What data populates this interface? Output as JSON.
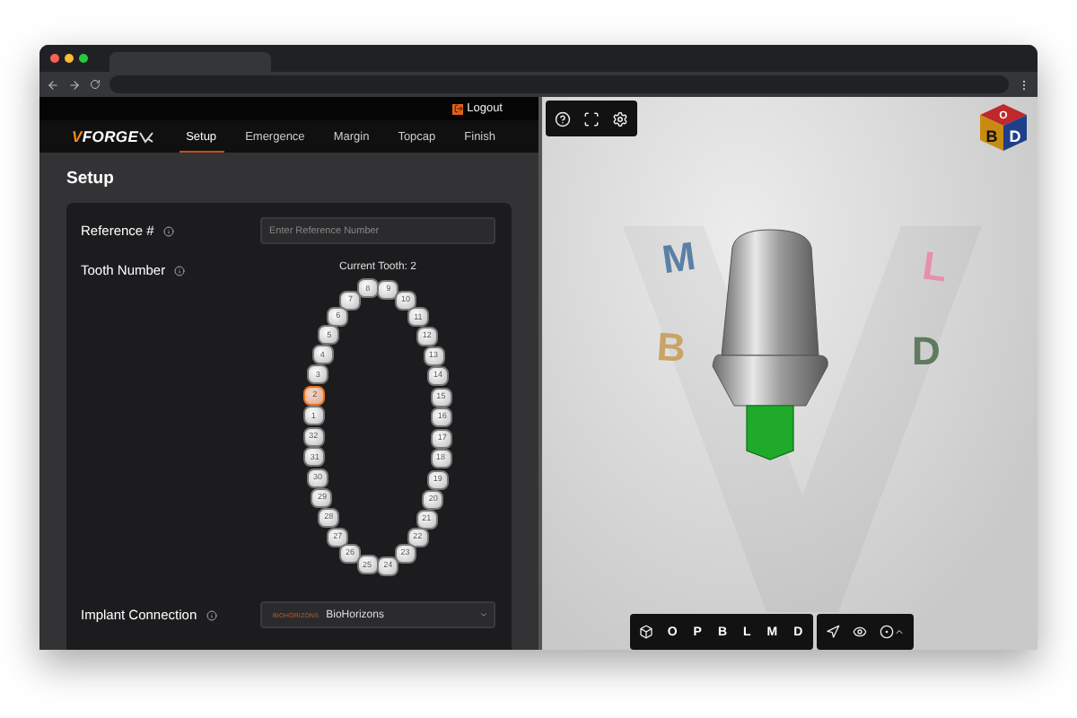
{
  "header": {
    "logout": "Logout"
  },
  "nav": {
    "logo": "VFORGE",
    "tabs": [
      {
        "label": "Setup",
        "selected": true
      },
      {
        "label": "Emergence",
        "selected": false
      },
      {
        "label": "Margin",
        "selected": false
      },
      {
        "label": "Topcap",
        "selected": false
      },
      {
        "label": "Finish",
        "selected": false
      }
    ]
  },
  "page_title": "Setup",
  "form": {
    "reference": {
      "label": "Reference #",
      "placeholder": "Enter Reference Number"
    },
    "tooth": {
      "label": "Tooth Number",
      "current": "Current Tooth: 2",
      "teeth": [
        {
          "label": "8",
          "selected": false
        },
        {
          "label": "9",
          "selected": false
        },
        {
          "label": "7",
          "selected": false
        },
        {
          "label": "10",
          "selected": false
        },
        {
          "label": "6",
          "selected": false
        },
        {
          "label": "11",
          "selected": false
        },
        {
          "label": "5",
          "selected": false
        },
        {
          "label": "12",
          "selected": false
        },
        {
          "label": "4",
          "selected": false
        },
        {
          "label": "13",
          "selected": false
        },
        {
          "label": "3",
          "selected": false
        },
        {
          "label": "14",
          "selected": false
        },
        {
          "label": "2",
          "selected": true
        },
        {
          "label": "15",
          "selected": false
        },
        {
          "label": "1",
          "selected": false
        },
        {
          "label": "16",
          "selected": false
        },
        {
          "label": "32",
          "selected": false
        },
        {
          "label": "17",
          "selected": false
        },
        {
          "label": "31",
          "selected": false
        },
        {
          "label": "18",
          "selected": false
        },
        {
          "label": "30",
          "selected": false
        },
        {
          "label": "19",
          "selected": false
        },
        {
          "label": "29",
          "selected": false
        },
        {
          "label": "20",
          "selected": false
        },
        {
          "label": "28",
          "selected": false
        },
        {
          "label": "21",
          "selected": false
        },
        {
          "label": "27",
          "selected": false
        },
        {
          "label": "22",
          "selected": false
        },
        {
          "label": "26",
          "selected": false
        },
        {
          "label": "23",
          "selected": false
        },
        {
          "label": "25",
          "selected": false
        },
        {
          "label": "24",
          "selected": false
        }
      ]
    },
    "implant": {
      "label": "Implant Connection",
      "brand_logo": "BIOHORIZONS",
      "value": "BioHorizons"
    }
  },
  "viewer": {
    "cube": {
      "top": "O",
      "left": "B",
      "right": "D"
    },
    "orientation_letters": [
      {
        "label": "M",
        "color": "#5b80a5"
      },
      {
        "label": "L",
        "color": "#e68fb0"
      },
      {
        "label": "B",
        "color": "#c9a466"
      },
      {
        "label": "D",
        "color": "#5f7a5f"
      }
    ],
    "view_buttons": [
      "O",
      "P",
      "B",
      "L",
      "M",
      "D"
    ]
  }
}
